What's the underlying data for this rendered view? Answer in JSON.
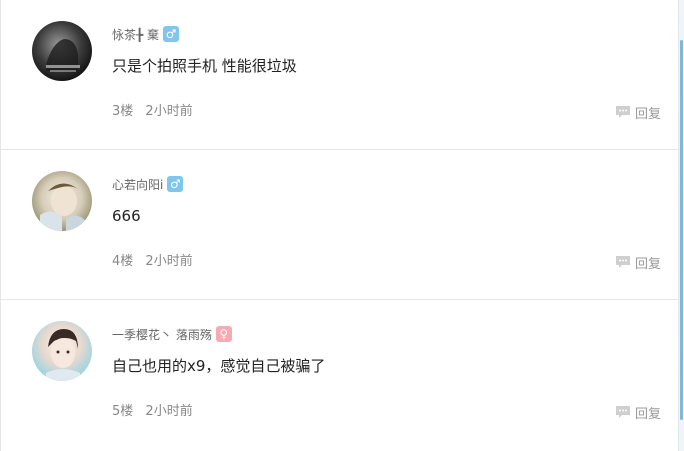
{
  "comments": [
    {
      "username": "怺茶╊ 棄",
      "gender": "male",
      "gender_symbol": "♂",
      "text": "只是个拍照手机  性能很垃圾",
      "floor": "3楼",
      "time": "2小时前",
      "reply_label": "回复"
    },
    {
      "username": "心若向阳i",
      "gender": "male",
      "gender_symbol": "♂",
      "text": "666",
      "floor": "4楼",
      "time": "2小时前",
      "reply_label": "回复"
    },
    {
      "username": "一季樱花丶 落雨殇",
      "gender": "female",
      "gender_symbol": "♀",
      "text": "自己也用的x9，感觉自己被骗了",
      "floor": "5楼",
      "time": "2小时前",
      "reply_label": "回复"
    }
  ],
  "colors": {
    "male_badge": "#7ec6ec",
    "female_badge": "#f7aab2",
    "divider": "#e6e6e6"
  },
  "icons": {
    "reply": "speech-bubble-icon"
  }
}
